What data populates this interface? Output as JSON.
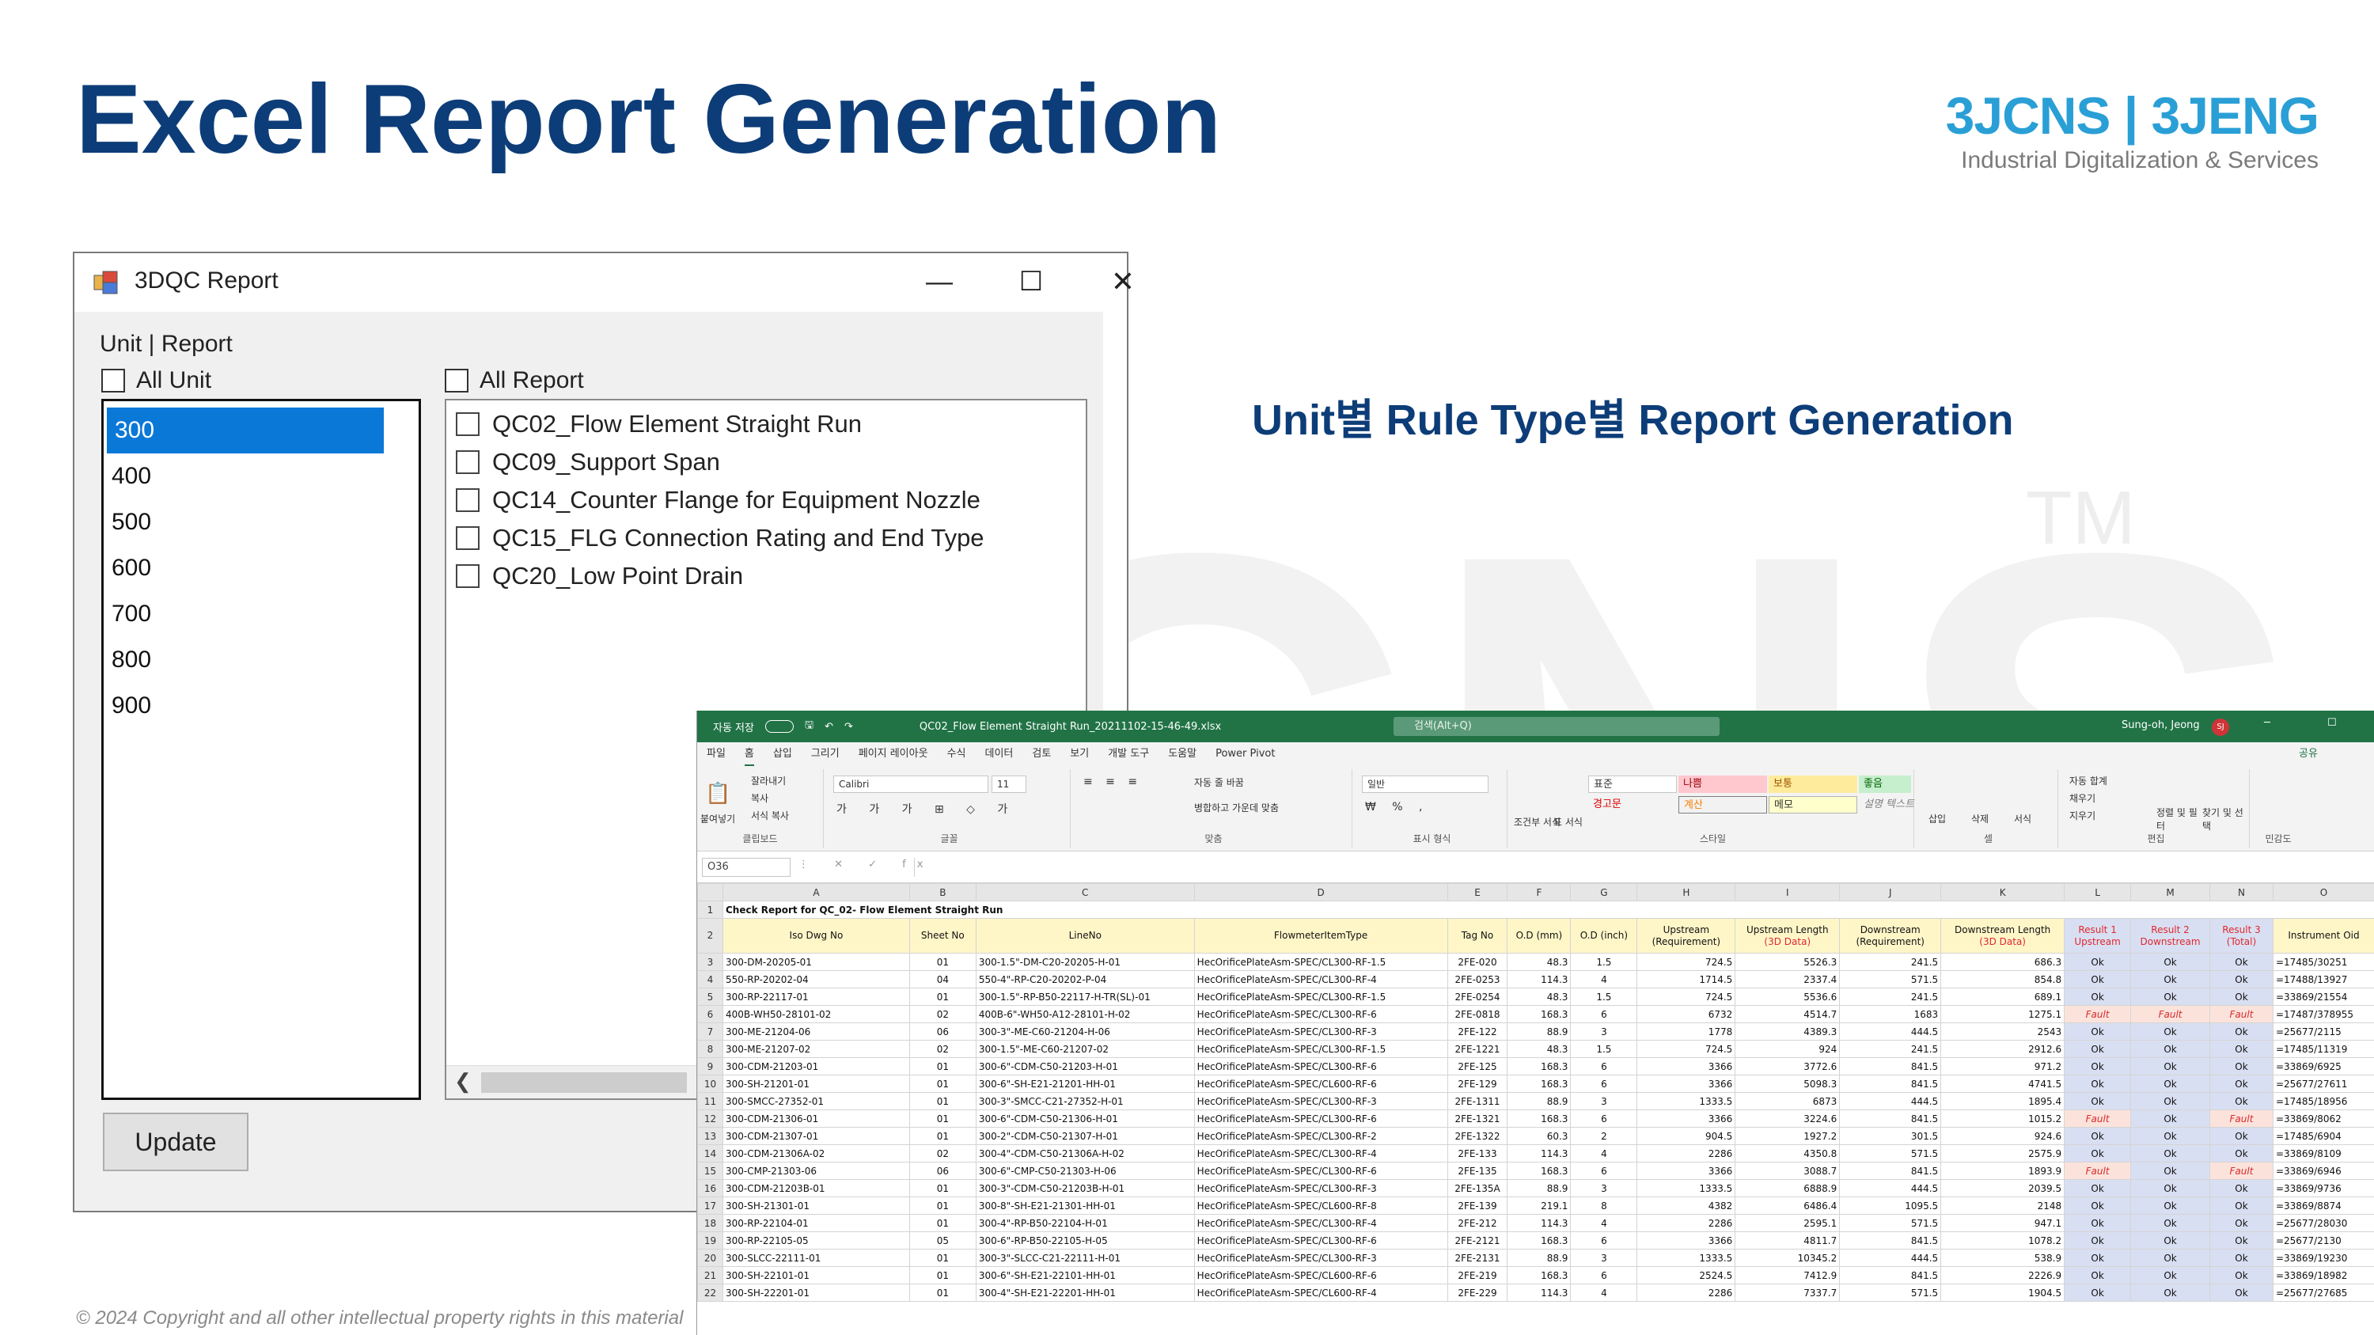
{
  "slide": {
    "title": "Excel Report Generation",
    "subtitle": "Unit별 Rule Type별 Report Generation",
    "footer": "© 2024 Copyright and all other intellectual property rights in this material",
    "watermark": "3JCNS",
    "watermark_tm": "TM"
  },
  "logo": {
    "brand": "3JCNS | 3JENG",
    "tagline": "Industrial Digitalization & Services",
    "color": "#2a9fd6"
  },
  "dialog": {
    "title": "3DQC Report",
    "window_controls": {
      "minimize": "—",
      "maximize": "☐",
      "close": "✕"
    },
    "group_label": "Unit | Report",
    "all_unit_label": "All Unit",
    "all_report_label": "All Report",
    "units": [
      "300",
      "400",
      "500",
      "600",
      "700",
      "800",
      "900"
    ],
    "selected_unit": "300",
    "reports": [
      "QC02_Flow Element Straight Run",
      "QC09_Support Span",
      "QC14_Counter Flange for Equipment Nozzle",
      "QC15_FLG Connection Rating and End Type",
      "QC20_Low Point Drain"
    ],
    "update_button": "Update",
    "selection_color": "#0a78d7"
  },
  "excel": {
    "titlebar": {
      "autosave": "자동 저장",
      "filename": "QC02_Flow Element Straight Run_20211102-15-46-49.xlsx",
      "search": "검색(Alt+Q)",
      "user": "Sung-oh, Jeong",
      "user_initials": "SJ"
    },
    "tabs": [
      "파일",
      "홈",
      "삽입",
      "그리기",
      "페이지 레이아웃",
      "수식",
      "데이터",
      "검토",
      "보기",
      "개발 도구",
      "도움말",
      "Power Pivot"
    ],
    "active_tab": "홈",
    "share": "공유",
    "ribbon": {
      "clipboard": {
        "paste": "붙여넣기",
        "cut": "잘라내기",
        "copy": "복사",
        "format_painter": "서식 복사",
        "label": "클립보드"
      },
      "font": {
        "name": "Calibri",
        "size": "11",
        "label": "글꼴"
      },
      "align": {
        "wrap": "자동 줄 바꿈",
        "merge": "병합하고 가운데 맞춤",
        "label": "맞춤"
      },
      "number": {
        "format": "일반",
        "label": "표시 형식"
      },
      "styles": {
        "conditional": "조건부 서식",
        "table": "표 서식",
        "normal": "표준",
        "bad": "나쁨",
        "neutral": "보통",
        "good": "좋음",
        "warning": "경고문",
        "calc": "계산",
        "memo": "메모",
        "explain": "설명 텍스트",
        "label": "스타일"
      },
      "cells": {
        "insert": "삽입",
        "delete": "삭제",
        "format": "서식",
        "label": "셀"
      },
      "editing": {
        "autosum": "자동 합계",
        "fill": "채우기",
        "clear": "지우기",
        "sort": "정렬 및 필터",
        "find": "찾기 및 선택",
        "label": "편집"
      },
      "sensitivity": {
        "label": "민감도"
      }
    },
    "name_box": "O36",
    "columns": [
      "",
      "A",
      "B",
      "C",
      "D",
      "E",
      "F",
      "G",
      "H",
      "I",
      "J",
      "K",
      "L",
      "M",
      "N",
      "O"
    ],
    "report_title": "Check Report for QC_02- Flow Element Straight Run",
    "headers": [
      {
        "main": "Iso Dwg No",
        "sub": ""
      },
      {
        "main": "Sheet No",
        "sub": ""
      },
      {
        "main": "LineNo",
        "sub": ""
      },
      {
        "main": "FlowmeterItemType",
        "sub": ""
      },
      {
        "main": "Tag No",
        "sub": ""
      },
      {
        "main": "O.D (mm)",
        "sub": ""
      },
      {
        "main": "O.D (inch)",
        "sub": ""
      },
      {
        "main": "Upstream",
        "sub": "(Requirement)"
      },
      {
        "main": "Upstream Length",
        "sub": "(3D Data)"
      },
      {
        "main": "Downstream",
        "sub": "(Requirement)"
      },
      {
        "main": "Downstream Length",
        "sub": "(3D Data)"
      },
      {
        "main": "Result 1",
        "sub": "Upstream"
      },
      {
        "main": "Result 2",
        "sub": "Downstream"
      },
      {
        "main": "Result 3",
        "sub": "(Total)"
      },
      {
        "main": "Instrument Oid",
        "sub": ""
      }
    ],
    "rows": [
      {
        "n": "3",
        "c": [
          "300-DM-20205-01",
          "01",
          "300-1.5\"-DM-C20-20205-H-01",
          "HecOrificePlateAsm-SPEC/CL300-RF-1.5",
          "2FE-020",
          "48.3",
          "1.5",
          "724.5",
          "5526.3",
          "241.5",
          "686.3",
          "Ok",
          "Ok",
          "Ok",
          "=17485/30251"
        ]
      },
      {
        "n": "4",
        "c": [
          "550-RP-20202-04",
          "04",
          "550-4\"-RP-C20-20202-P-04",
          "HecOrificePlateAsm-SPEC/CL300-RF-4",
          "2FE-0253",
          "114.3",
          "4",
          "1714.5",
          "2337.4",
          "571.5",
          "854.8",
          "Ok",
          "Ok",
          "Ok",
          "=17488/13927"
        ]
      },
      {
        "n": "5",
        "c": [
          "300-RP-22117-01",
          "01",
          "300-1.5\"-RP-B50-22117-H-TR(SL)-01",
          "HecOrificePlateAsm-SPEC/CL300-RF-1.5",
          "2FE-0254",
          "48.3",
          "1.5",
          "724.5",
          "5536.6",
          "241.5",
          "689.1",
          "Ok",
          "Ok",
          "Ok",
          "=33869/21554"
        ]
      },
      {
        "n": "6",
        "c": [
          "400B-WH50-28101-02",
          "02",
          "400B-6\"-WH50-A12-28101-H-02",
          "HecOrificePlateAsm-SPEC/CL300-RF-6",
          "2FE-0818",
          "168.3",
          "6",
          "6732",
          "4514.7",
          "1683",
          "1275.1",
          "Fault",
          "Fault",
          "Fault",
          "=17487/378955"
        ]
      },
      {
        "n": "7",
        "c": [
          "300-ME-21204-06",
          "06",
          "300-3\"-ME-C60-21204-H-06",
          "HecOrificePlateAsm-SPEC/CL300-RF-3",
          "2FE-122",
          "88.9",
          "3",
          "1778",
          "4389.3",
          "444.5",
          "2543",
          "Ok",
          "Ok",
          "Ok",
          "=25677/2115"
        ]
      },
      {
        "n": "8",
        "c": [
          "300-ME-21207-02",
          "02",
          "300-1.5\"-ME-C60-21207-02",
          "HecOrificePlateAsm-SPEC/CL300-RF-1.5",
          "2FE-1221",
          "48.3",
          "1.5",
          "724.5",
          "924",
          "241.5",
          "2912.6",
          "Ok",
          "Ok",
          "Ok",
          "=17485/11319"
        ]
      },
      {
        "n": "9",
        "c": [
          "300-CDM-21203-01",
          "01",
          "300-6\"-CDM-C50-21203-H-01",
          "HecOrificePlateAsm-SPEC/CL300-RF-6",
          "2FE-125",
          "168.3",
          "6",
          "3366",
          "3772.6",
          "841.5",
          "971.2",
          "Ok",
          "Ok",
          "Ok",
          "=33869/6925"
        ]
      },
      {
        "n": "10",
        "c": [
          "300-SH-21201-01",
          "01",
          "300-6\"-SH-E21-21201-HH-01",
          "HecOrificePlateAsm-SPEC/CL600-RF-6",
          "2FE-129",
          "168.3",
          "6",
          "3366",
          "5098.3",
          "841.5",
          "4741.5",
          "Ok",
          "Ok",
          "Ok",
          "=25677/27611"
        ]
      },
      {
        "n": "11",
        "c": [
          "300-SMCC-27352-01",
          "01",
          "300-3\"-SMCC-C21-27352-H-01",
          "HecOrificePlateAsm-SPEC/CL300-RF-3",
          "2FE-1311",
          "88.9",
          "3",
          "1333.5",
          "6873",
          "444.5",
          "1895.4",
          "Ok",
          "Ok",
          "Ok",
          "=17485/18956"
        ]
      },
      {
        "n": "12",
        "c": [
          "300-CDM-21306-01",
          "01",
          "300-6\"-CDM-C50-21306-H-01",
          "HecOrificePlateAsm-SPEC/CL300-RF-6",
          "2FE-1321",
          "168.3",
          "6",
          "3366",
          "3224.6",
          "841.5",
          "1015.2",
          "Fault",
          "Ok",
          "Fault",
          "=33869/8062"
        ]
      },
      {
        "n": "13",
        "c": [
          "300-CDM-21307-01",
          "01",
          "300-2\"-CDM-C50-21307-H-01",
          "HecOrificePlateAsm-SPEC/CL300-RF-2",
          "2FE-1322",
          "60.3",
          "2",
          "904.5",
          "1927.2",
          "301.5",
          "924.6",
          "Ok",
          "Ok",
          "Ok",
          "=17485/6904"
        ]
      },
      {
        "n": "14",
        "c": [
          "300-CDM-21306A-02",
          "02",
          "300-4\"-CDM-C50-21306A-H-02",
          "HecOrificePlateAsm-SPEC/CL300-RF-4",
          "2FE-133",
          "114.3",
          "4",
          "2286",
          "4350.8",
          "571.5",
          "2575.9",
          "Ok",
          "Ok",
          "Ok",
          "=33869/8109"
        ]
      },
      {
        "n": "15",
        "c": [
          "300-CMP-21303-06",
          "06",
          "300-6\"-CMP-C50-21303-H-06",
          "HecOrificePlateAsm-SPEC/CL300-RF-6",
          "2FE-135",
          "168.3",
          "6",
          "3366",
          "3088.7",
          "841.5",
          "1893.9",
          "Fault",
          "Ok",
          "Fault",
          "=33869/6946"
        ]
      },
      {
        "n": "16",
        "c": [
          "300-CDM-21203B-01",
          "01",
          "300-3\"-CDM-C50-21203B-H-01",
          "HecOrificePlateAsm-SPEC/CL300-RF-3",
          "2FE-135A",
          "88.9",
          "3",
          "1333.5",
          "6888.9",
          "444.5",
          "2039.5",
          "Ok",
          "Ok",
          "Ok",
          "=33869/9736"
        ]
      },
      {
        "n": "17",
        "c": [
          "300-SH-21301-01",
          "01",
          "300-8\"-SH-E21-21301-HH-01",
          "HecOrificePlateAsm-SPEC/CL600-RF-8",
          "2FE-139",
          "219.1",
          "8",
          "4382",
          "6486.4",
          "1095.5",
          "2148",
          "Ok",
          "Ok",
          "Ok",
          "=33869/8874"
        ]
      },
      {
        "n": "18",
        "c": [
          "300-RP-22104-01",
          "01",
          "300-4\"-RP-B50-22104-H-01",
          "HecOrificePlateAsm-SPEC/CL300-RF-4",
          "2FE-212",
          "114.3",
          "4",
          "2286",
          "2595.1",
          "571.5",
          "947.1",
          "Ok",
          "Ok",
          "Ok",
          "=25677/28030"
        ]
      },
      {
        "n": "19",
        "c": [
          "300-RP-22105-05",
          "05",
          "300-6\"-RP-B50-22105-H-05",
          "HecOrificePlateAsm-SPEC/CL300-RF-6",
          "2FE-2121",
          "168.3",
          "6",
          "3366",
          "4811.7",
          "841.5",
          "1078.2",
          "Ok",
          "Ok",
          "Ok",
          "=25677/2130"
        ]
      },
      {
        "n": "20",
        "c": [
          "300-SLCC-22111-01",
          "01",
          "300-3\"-SLCC-C21-22111-H-01",
          "HecOrificePlateAsm-SPEC/CL300-RF-3",
          "2FE-2131",
          "88.9",
          "3",
          "1333.5",
          "10345.2",
          "444.5",
          "538.9",
          "Ok",
          "Ok",
          "Ok",
          "=33869/19230"
        ]
      },
      {
        "n": "21",
        "c": [
          "300-SH-22101-01",
          "01",
          "300-6\"-SH-E21-22101-HH-01",
          "HecOrificePlateAsm-SPEC/CL600-RF-6",
          "2FE-219",
          "168.3",
          "6",
          "2524.5",
          "7412.9",
          "841.5",
          "2226.9",
          "Ok",
          "Ok",
          "Ok",
          "=33869/18982"
        ]
      },
      {
        "n": "22",
        "c": [
          "300-SH-22201-01",
          "01",
          "300-4\"-SH-E21-22201-HH-01",
          "HecOrificePlateAsm-SPEC/CL600-RF-4",
          "2FE-229",
          "114.3",
          "4",
          "2286",
          "7337.7",
          "571.5",
          "1904.5",
          "Ok",
          "Ok",
          "Ok",
          "=25677/27685"
        ]
      }
    ],
    "colors": {
      "header_fill": "#fff6c8",
      "result_fill": "#d9dff2",
      "fault_fill": "#fbe3dc",
      "fault_text": "#d92b2b",
      "excel_green": "#217346"
    }
  }
}
